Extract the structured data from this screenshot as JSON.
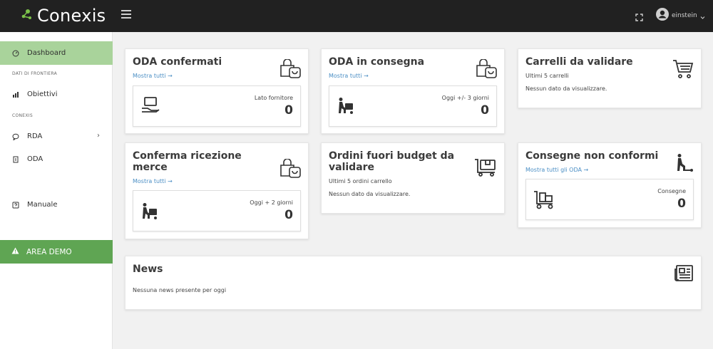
{
  "header": {
    "brand": "Conexis",
    "user_name": "einstein"
  },
  "sidebar": {
    "items": [
      {
        "label": "Dashboard",
        "icon": "gauge-icon"
      },
      {
        "label": "Obiettivi",
        "icon": "bar-chart-icon"
      },
      {
        "label": "RDA",
        "icon": "chat-icon"
      },
      {
        "label": "ODA",
        "icon": "document-icon"
      },
      {
        "label": "Manuale",
        "icon": "help-icon"
      }
    ],
    "sections": [
      "DATI DI FRONTIERA",
      "CONEXIS"
    ],
    "area_demo": "AREA DEMO"
  },
  "cards": {
    "oda_confermati": {
      "title": "ODA confermati",
      "link": "Mostra tutti",
      "label": "Lato fornitore",
      "value": "0"
    },
    "oda_consegna": {
      "title": "ODA in consegna",
      "link": "Mostra tutti",
      "label": "Oggi +/- 3 giorni",
      "value": "0"
    },
    "carrelli": {
      "title": "Carrelli da validare",
      "sub": "Ultimi 5 carrelli",
      "empty": "Nessun dato da visualizzare."
    },
    "conferma": {
      "title_line1": "Conferma ricezione",
      "title_line2": "merce",
      "link": "Mostra tutti",
      "label": "Oggi + 2 giorni",
      "value": "0"
    },
    "ordini": {
      "title_line1": "Ordini fuori budget da",
      "title_line2": "validare",
      "sub": "Ultimi 5 ordini carrello",
      "empty": "Nessun dato da visualizzare."
    },
    "consegne": {
      "title": "Consegne non conformi",
      "link": "Mostra tutti gli ODA",
      "label": "Consegne",
      "value": "0"
    },
    "news": {
      "title": "News",
      "empty": "Nessuna news presente per oggi"
    }
  },
  "colors": {
    "topbar": "#212121",
    "active_nav": "#a9d39b",
    "area_demo": "#5fa553",
    "link": "#4a8ec4",
    "logo_green": "#7cc24a"
  }
}
